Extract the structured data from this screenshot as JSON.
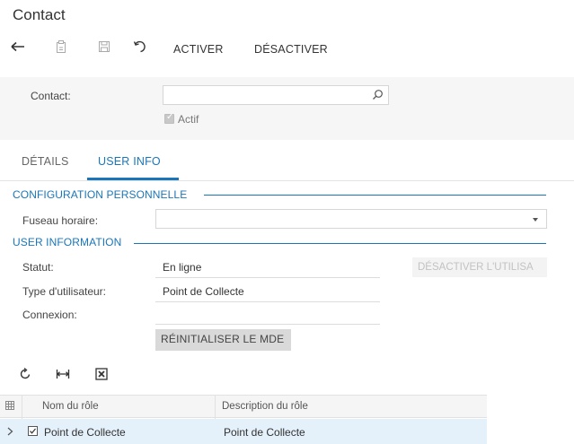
{
  "page": {
    "title": "Contact"
  },
  "toolbar": {
    "activate_label": "ACTIVER",
    "deactivate_label": "DÉSACTIVER"
  },
  "form": {
    "contact_label": "Contact:",
    "contact_value": "",
    "active_label": "Actif",
    "active_checked": true
  },
  "tabs": [
    {
      "label": "DÉTAILS",
      "active": false
    },
    {
      "label": "USER INFO",
      "active": true
    }
  ],
  "personal_config": {
    "title": "CONFIGURATION PERSONNELLE",
    "timezone_label": "Fuseau horaire:",
    "timezone_value": ""
  },
  "user_information": {
    "title": "USER INFORMATION",
    "status_label": "Statut:",
    "status_value": "En ligne",
    "deactivate_user_button": "DÉSACTIVER L'UTILISA",
    "user_type_label": "Type d'utilisateur:",
    "user_type_value": "Point de Collecte",
    "login_label": "Connexion:",
    "login_value": "",
    "reset_password_button": "RÉINITIALISER LE MDE"
  },
  "roles_grid": {
    "columns": [
      "Nom du rôle",
      "Description du rôle"
    ],
    "rows": [
      {
        "role": "Point de Collecte",
        "description": "Point de Collecte",
        "checked": true
      }
    ]
  },
  "colors": {
    "accent": "#1a76b8",
    "selected_row": "#e4f0fa",
    "panel": "#f6f6f6"
  },
  "icons": [
    "back-arrow-icon",
    "copy-icon",
    "save-icon",
    "undo-icon",
    "search-icon",
    "refresh-icon",
    "fit-columns-icon",
    "excel-export-icon",
    "grid-settings-icon",
    "row-expand-icon"
  ]
}
